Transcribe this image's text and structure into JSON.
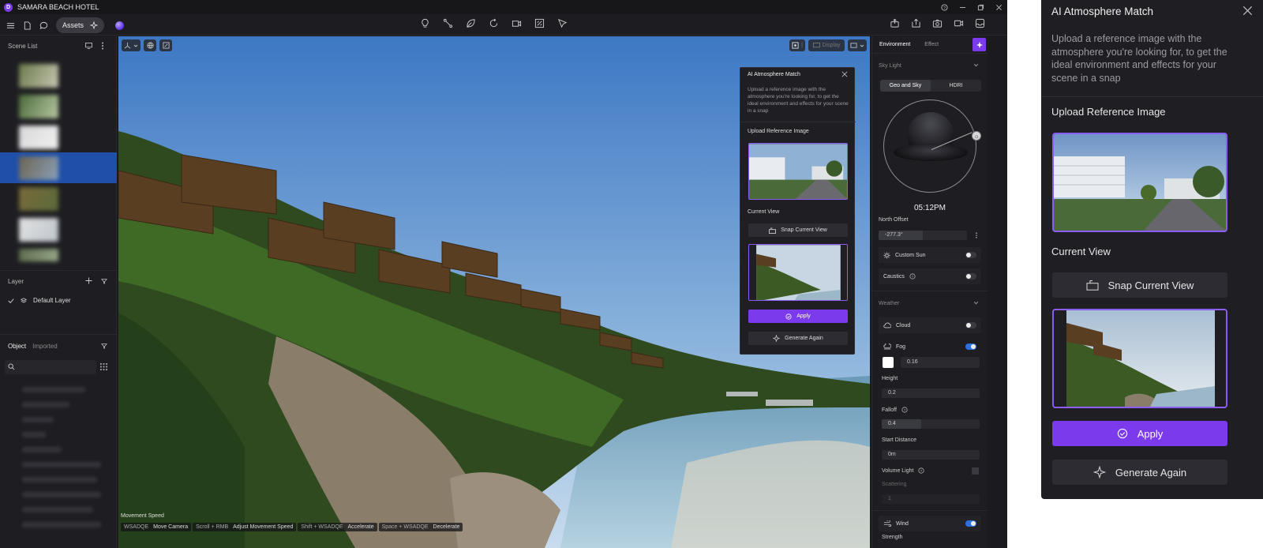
{
  "window": {
    "title": "SAMARA BEACH HOTEL"
  },
  "toolbar": {
    "assets_label": "Assets"
  },
  "left_panel": {
    "scene_list_title": "Scene List",
    "layer_title": "Layer",
    "default_layer": "Default Layer",
    "tab_object": "Object",
    "tab_imported": "Imported"
  },
  "viewport": {
    "display_label": "Display",
    "movement_title": "Movement Speed",
    "hints": [
      {
        "key": "WSADQE",
        "action": "Move Camera"
      },
      {
        "key": "Scroll + RMB",
        "action": "Adjust Movement Speed"
      },
      {
        "key": "Shift + WSADQE",
        "action": "Accelerate"
      },
      {
        "key": "Space + WSADQE",
        "action": "Decelerate"
      }
    ]
  },
  "ai_panel": {
    "title": "AI Atmosphere Match",
    "description": "Upload a reference image with the atmosphere you're looking for, to get the ideal environment and effects for your scene in a snap",
    "upload_label": "Upload Reference Image",
    "current_view_label": "Current View",
    "snap_button": "Snap Current View",
    "apply_button": "Apply",
    "generate_button": "Generate Again"
  },
  "right_panel": {
    "tab_environment": "Environment",
    "tab_effect": "Effect",
    "sky_light_title": "Sky Light",
    "seg_geo": "Geo and Sky",
    "seg_hdri": "HDRI",
    "time": "05:12PM",
    "north_offset_label": "North Offset",
    "north_offset_value": "-277.3°",
    "custom_sun_label": "Custom Sun",
    "caustics_label": "Caustics",
    "weather_title": "Weather",
    "cloud_label": "Cloud",
    "fog_label": "Fog",
    "fog_density": "0.16",
    "height_label": "Height",
    "height_value": "0.2",
    "falloff_label": "Falloff",
    "falloff_value": "0.4",
    "start_distance_label": "Start Distance",
    "start_distance_value": "0m",
    "volume_light_label": "Volume Light",
    "scattering_label": "Scattering",
    "scattering_value": "1",
    "wind_label": "Wind",
    "strength_label": "Strength"
  },
  "toggles": {
    "custom_sun": false,
    "caustics": false,
    "cloud": false,
    "fog": true,
    "wind": true
  },
  "colors": {
    "accent": "#7c3aed",
    "toggle_on": "#2f6fe0",
    "selection": "#1f4fa8"
  }
}
